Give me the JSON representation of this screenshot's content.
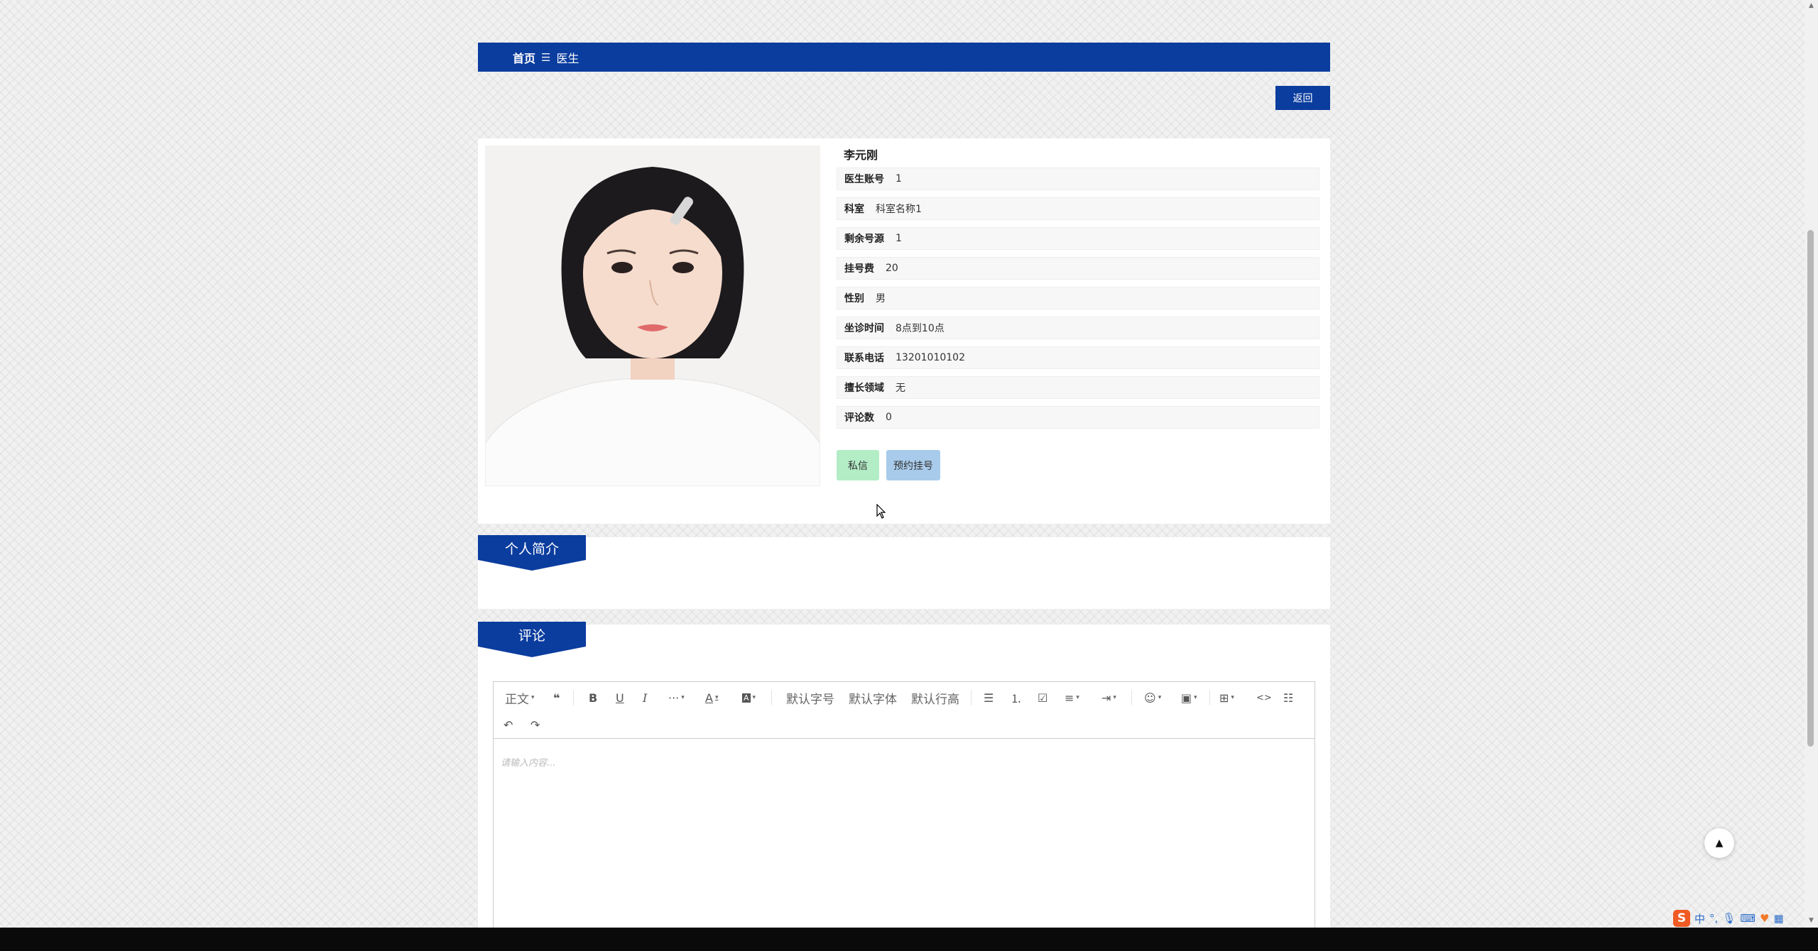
{
  "breadcrumb": {
    "home": "首页",
    "separator": "☰",
    "current": "医生"
  },
  "back_button": "返回",
  "doctor": {
    "name": "李元刚",
    "fields": [
      {
        "label": "医生账号",
        "value": "1"
      },
      {
        "label": "科室",
        "value": "科室名称1"
      },
      {
        "label": "剩余号源",
        "value": "1"
      },
      {
        "label": "挂号费",
        "value": "20"
      },
      {
        "label": "性别",
        "value": "男"
      },
      {
        "label": "坐诊时间",
        "value": "8点到10点"
      },
      {
        "label": "联系电话",
        "value": "13201010102"
      },
      {
        "label": "擅长领域",
        "value": "无"
      },
      {
        "label": "评论数",
        "value": "0"
      }
    ]
  },
  "actions": {
    "message": "私信",
    "book": "预约挂号"
  },
  "sections": {
    "intro": "个人简介",
    "comment": "评论"
  },
  "editor": {
    "toolbar": {
      "paragraph": "正文",
      "font_size": "默认字号",
      "font_family": "默认字体",
      "line_height": "默认行高"
    },
    "placeholder": "请输入内容..."
  },
  "ime": {
    "lang": "中"
  },
  "colors": {
    "primary": "#0b3d9f",
    "message_btn": "#b3edc6",
    "book_btn": "#a8cbeb"
  }
}
